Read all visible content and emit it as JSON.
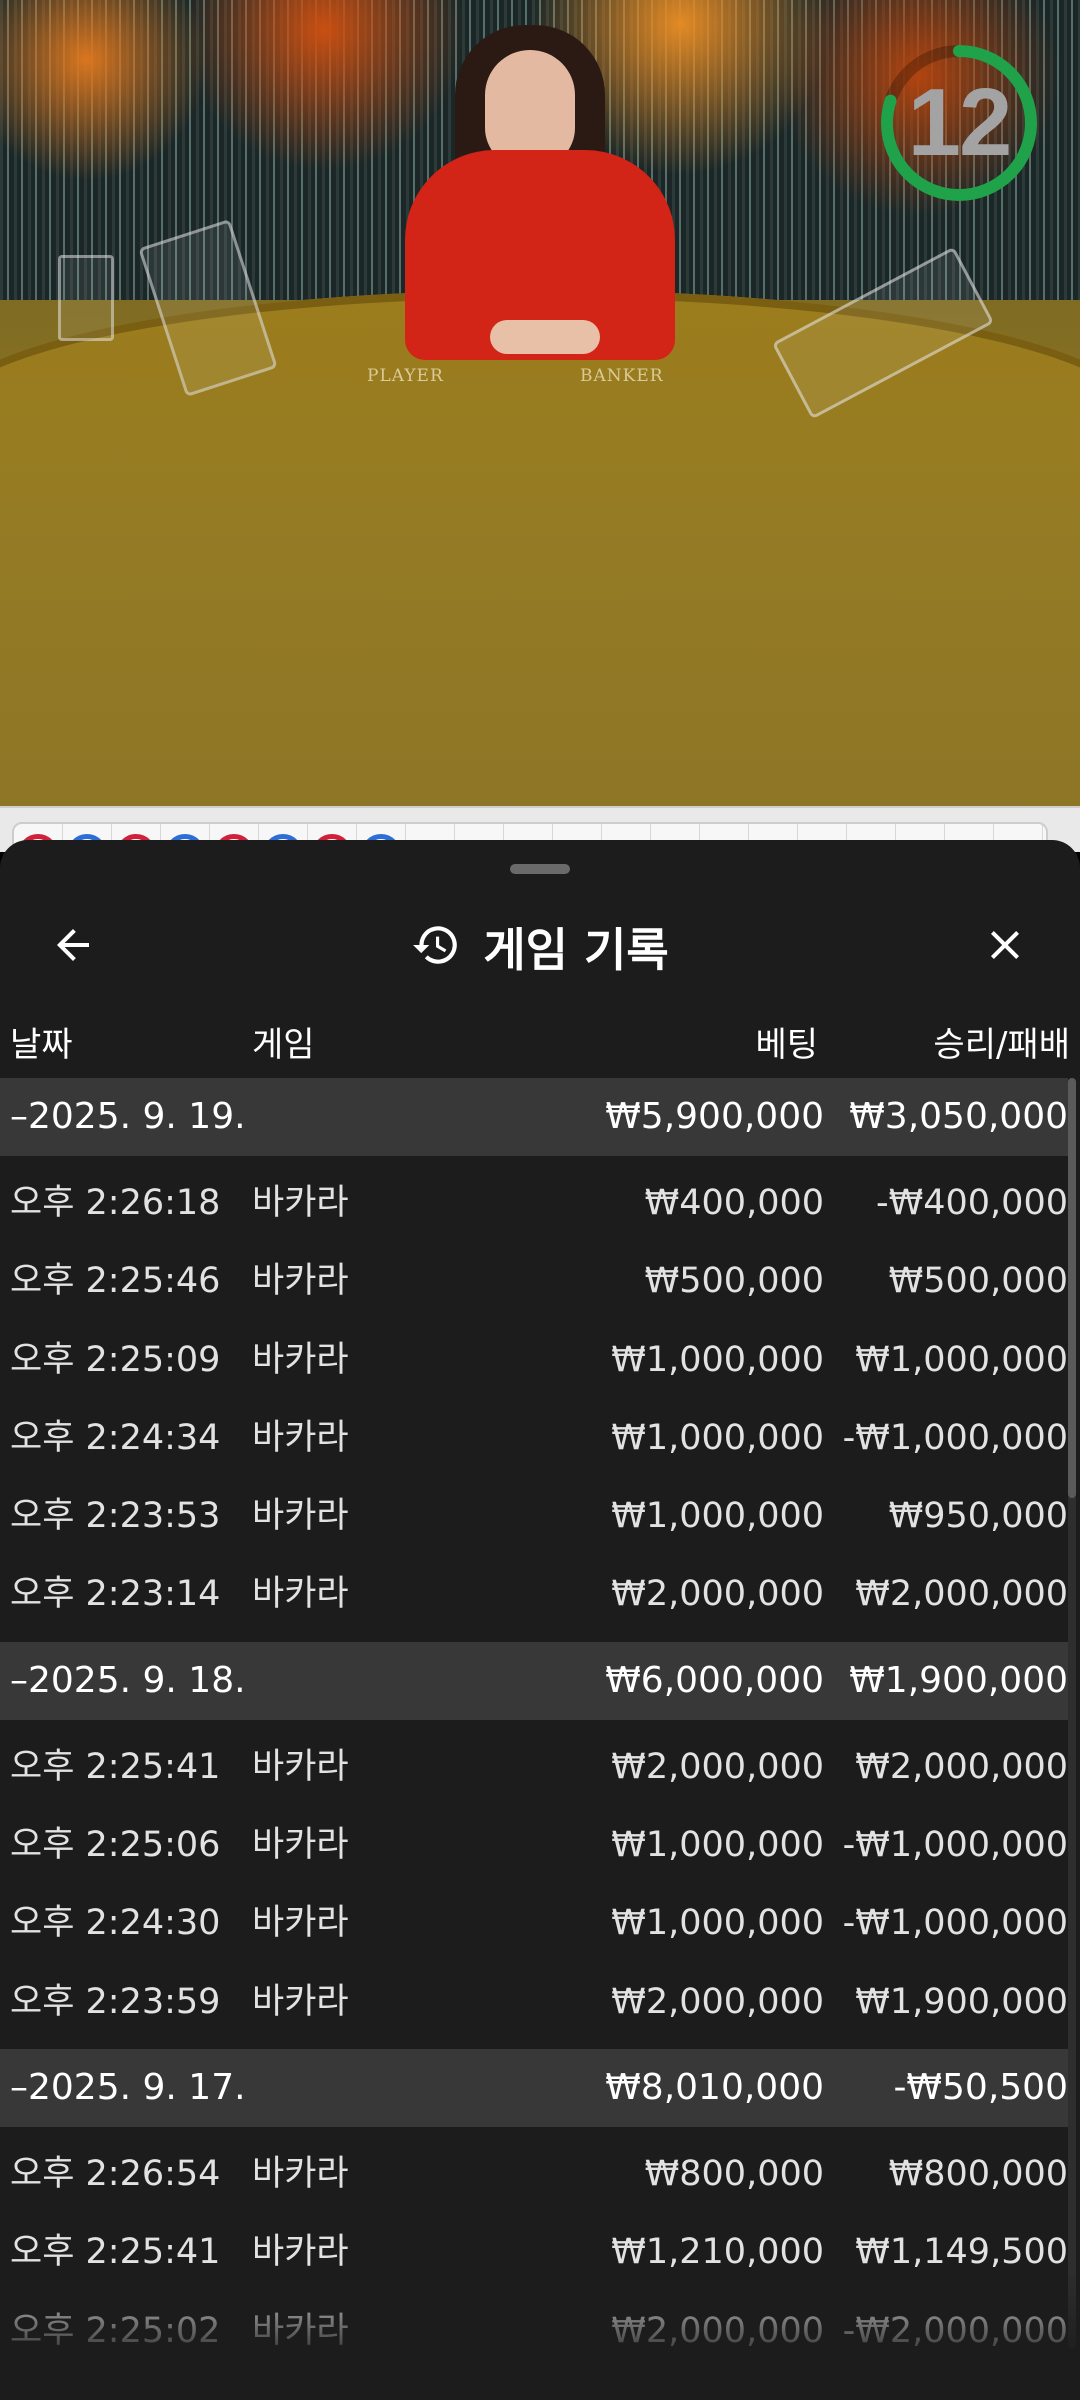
{
  "video": {
    "countdown": "12",
    "countdown_fraction": 0.8,
    "table_labels": [
      "PLAYER",
      "BANKER"
    ]
  },
  "bead_road": {
    "beads": [
      "red",
      "blue",
      "red",
      "blue",
      "red",
      "blue",
      "red",
      "blue"
    ],
    "colors": {
      "red": "#d0203a",
      "blue": "#2c6ed5",
      "green": "#2a8f45"
    }
  },
  "history": {
    "title": "게임 기록",
    "columns": {
      "date": "날짜",
      "game": "게임",
      "bet": "베팅",
      "winloss": "승리/패배"
    },
    "groups": [
      {
        "date": "–2025. 9. 19.",
        "bet_total": "₩5,900,000",
        "winloss_total": "₩3,050,000",
        "rows": [
          {
            "time": "오후 2:26:18",
            "game": "바카라",
            "bet": "₩400,000",
            "winloss": "-₩400,000"
          },
          {
            "time": "오후 2:25:46",
            "game": "바카라",
            "bet": "₩500,000",
            "winloss": "₩500,000"
          },
          {
            "time": "오후 2:25:09",
            "game": "바카라",
            "bet": "₩1,000,000",
            "winloss": "₩1,000,000"
          },
          {
            "time": "오후 2:24:34",
            "game": "바카라",
            "bet": "₩1,000,000",
            "winloss": "-₩1,000,000"
          },
          {
            "time": "오후 2:23:53",
            "game": "바카라",
            "bet": "₩1,000,000",
            "winloss": "₩950,000"
          },
          {
            "time": "오후 2:23:14",
            "game": "바카라",
            "bet": "₩2,000,000",
            "winloss": "₩2,000,000"
          }
        ]
      },
      {
        "date": "–2025. 9. 18.",
        "bet_total": "₩6,000,000",
        "winloss_total": "₩1,900,000",
        "rows": [
          {
            "time": "오후 2:25:41",
            "game": "바카라",
            "bet": "₩2,000,000",
            "winloss": "₩2,000,000"
          },
          {
            "time": "오후 2:25:06",
            "game": "바카라",
            "bet": "₩1,000,000",
            "winloss": "-₩1,000,000"
          },
          {
            "time": "오후 2:24:30",
            "game": "바카라",
            "bet": "₩1,000,000",
            "winloss": "-₩1,000,000"
          },
          {
            "time": "오후 2:23:59",
            "game": "바카라",
            "bet": "₩2,000,000",
            "winloss": "₩1,900,000"
          }
        ]
      },
      {
        "date": "–2025. 9. 17.",
        "bet_total": "₩8,010,000",
        "winloss_total": "-₩50,500",
        "rows": [
          {
            "time": "오후 2:26:54",
            "game": "바카라",
            "bet": "₩800,000",
            "winloss": "₩800,000"
          },
          {
            "time": "오후 2:25:41",
            "game": "바카라",
            "bet": "₩1,210,000",
            "winloss": "₩1,149,500"
          },
          {
            "time": "오후 2:25:02",
            "game": "바카라",
            "bet": "₩2,000,000",
            "winloss": "-₩2,000,000"
          }
        ]
      }
    ]
  },
  "icons": {
    "back": "arrow-left-icon",
    "history": "history-icon",
    "close": "close-icon"
  }
}
